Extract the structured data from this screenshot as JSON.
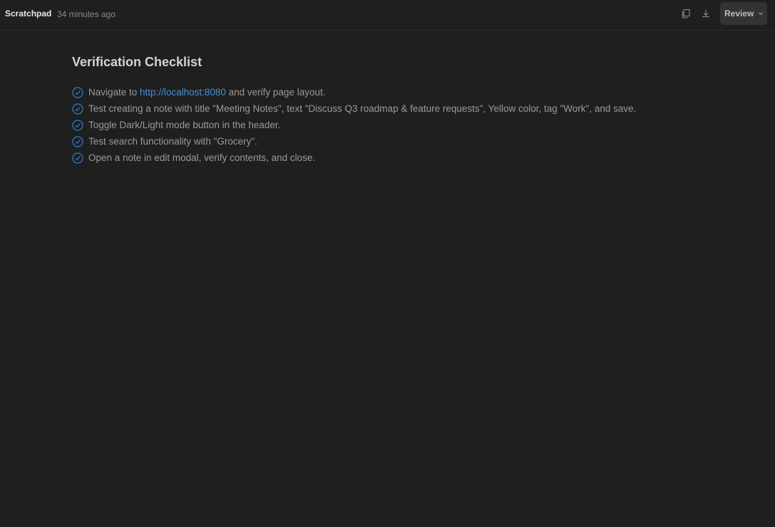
{
  "header": {
    "title": "Scratchpad",
    "timestamp": "34 minutes ago",
    "review_label": "Review"
  },
  "doc": {
    "title": "Verification Checklist",
    "items": [
      {
        "before": "Navigate to ",
        "link": "http://localhost:8080",
        "after": " and verify page layout."
      },
      {
        "text": "Test creating a note with title \"Meeting Notes\", text \"Discuss Q3 roadmap & feature requests\", Yellow color, tag \"Work\", and save."
      },
      {
        "text": "Toggle Dark/Light mode button in the header."
      },
      {
        "text": "Test search functionality with \"Grocery\"."
      },
      {
        "text": "Open a note in edit modal, verify contents, and close."
      }
    ]
  },
  "icons": {
    "copy": "copy-icon",
    "download": "download-icon",
    "chevron": "chevron-down-icon",
    "check": "check-circle-icon"
  },
  "colors": {
    "background": "#1f1f1f",
    "accent": "#2f7fd1",
    "link": "#4a8fd6"
  }
}
